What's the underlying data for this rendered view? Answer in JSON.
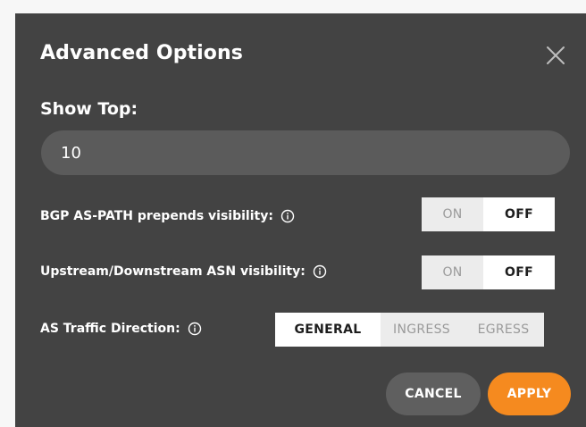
{
  "dialog": {
    "title": "Advanced Options",
    "close_icon": "close-icon"
  },
  "show_top": {
    "label": "Show Top:",
    "value": "10"
  },
  "bgp_prepends": {
    "label": "BGP AS-PATH prepends visibility:",
    "info_icon": "info-icon",
    "options": [
      "ON",
      "OFF"
    ],
    "selected": "OFF"
  },
  "asn_visibility": {
    "label": "Upstream/Downstream ASN visibility:",
    "info_icon": "info-icon",
    "options": [
      "ON",
      "OFF"
    ],
    "selected": "OFF"
  },
  "traffic_direction": {
    "label": "AS Traffic Direction:",
    "info_icon": "info-icon",
    "options": [
      "GENERAL",
      "INGRESS",
      "EGRESS"
    ],
    "selected": "GENERAL"
  },
  "actions": {
    "cancel_label": "CANCEL",
    "apply_label": "APPLY"
  },
  "colors": {
    "dialog_bg": "#434343",
    "input_bg": "#5b5b5b",
    "apply_accent": "#f58a1f",
    "cancel_bg": "#5f5f5f",
    "toggle_inactive_bg": "#ececec",
    "toggle_active_bg": "#ffffff"
  }
}
